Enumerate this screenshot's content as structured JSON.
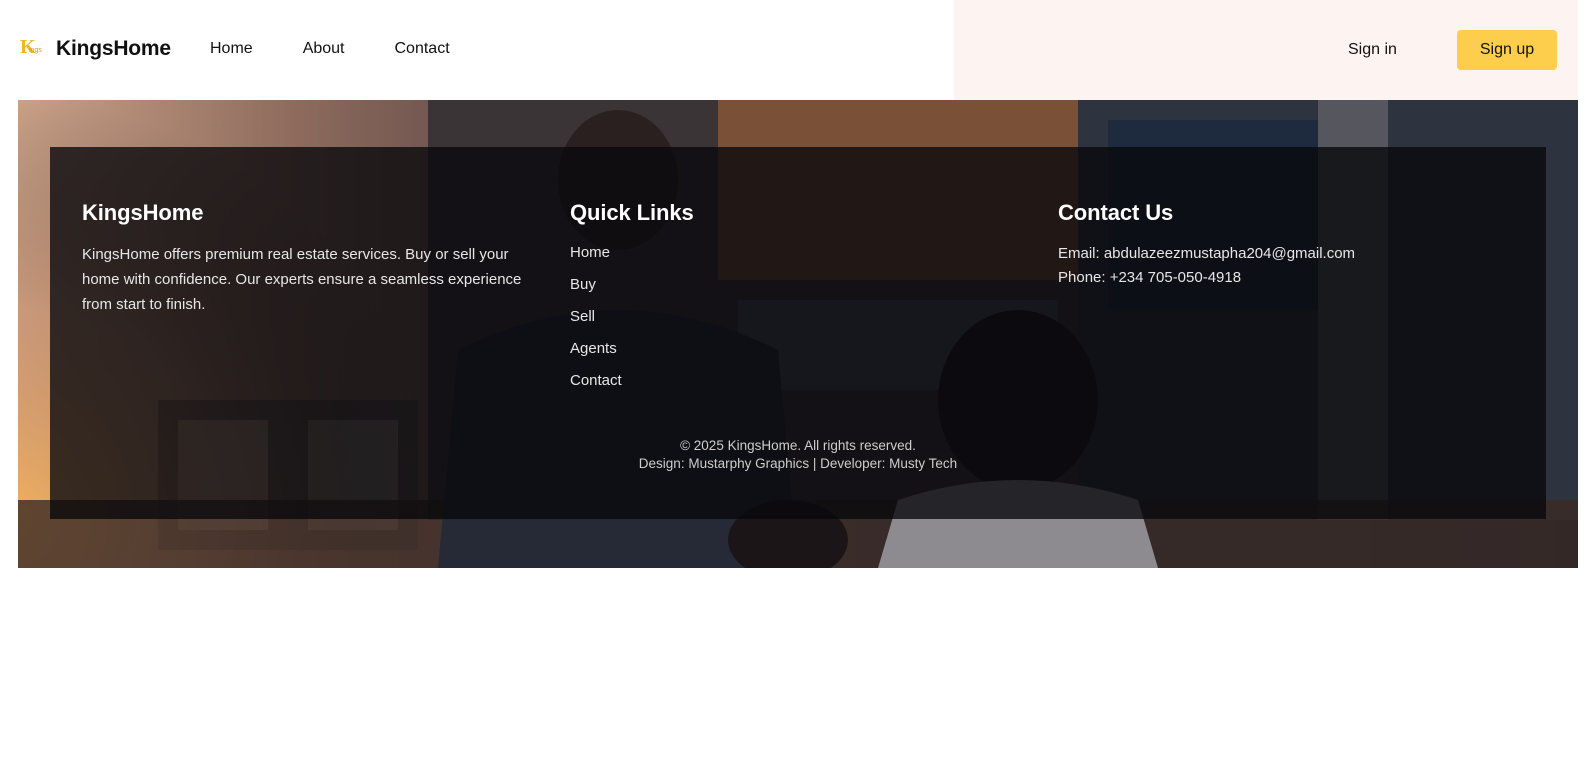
{
  "header": {
    "brand": {
      "logo_letter": "K",
      "logo_sub": "ings",
      "name": "KingsHome"
    },
    "nav": [
      "Home",
      "About",
      "Contact"
    ],
    "signin": "Sign in",
    "signup": "Sign up",
    "accent": "#fcce4c"
  },
  "footer": {
    "about": {
      "title": "KingsHome",
      "text": "KingsHome offers premium real estate services. Buy or sell your home with confidence. Our experts ensure a seamless experience from start to finish."
    },
    "links": {
      "title": "Quick Links",
      "items": [
        "Home",
        "Buy",
        "Sell",
        "Agents",
        "Contact"
      ]
    },
    "contact": {
      "title": "Contact Us",
      "email": "Email: abdulazeezmustapha204@gmail.com",
      "phone": "Phone: +234 705-050-4918"
    },
    "copyright": "© 2025 KingsHome. All rights reserved.",
    "credits": "Design: Mustarphy Graphics | Developer: Musty Tech"
  }
}
